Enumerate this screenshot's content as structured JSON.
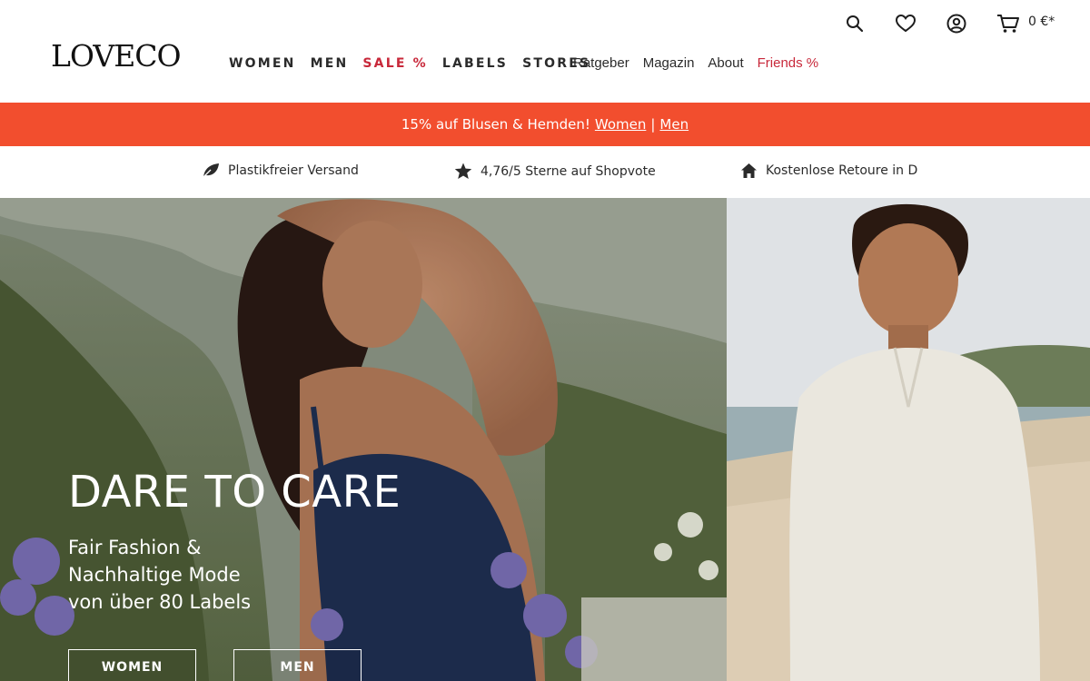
{
  "brand": {
    "logo_text": "LOVECO"
  },
  "main_nav": [
    {
      "label": "WOMEN"
    },
    {
      "label": "MEN"
    },
    {
      "label": "SALE %"
    },
    {
      "label": "LABELS"
    },
    {
      "label": "STORES"
    }
  ],
  "sub_nav": [
    {
      "label": "Ratgeber"
    },
    {
      "label": "Magazin"
    },
    {
      "label": "About"
    },
    {
      "label": "Friends %"
    }
  ],
  "header_icons": {
    "search": "search-icon",
    "wishlist": "heart-icon",
    "account": "user-icon",
    "cart": "cart-icon",
    "cart_total": "0 €*"
  },
  "promo": {
    "text": "15% auf Blusen & Hemden!",
    "link_women": "Women",
    "separator": "|",
    "link_men": "Men",
    "color": "#f24e2e"
  },
  "usp": [
    {
      "icon": "leaf-icon",
      "text": "Plastikfreier Versand"
    },
    {
      "icon": "star-icon",
      "text": "4,76/5 Sterne auf Shopvote"
    },
    {
      "icon": "home-icon",
      "text": "Kostenlose Retoure in D"
    }
  ],
  "hero": {
    "title": "DARE TO CARE",
    "subtitle_lines": [
      "Fair Fashion &",
      "Nachhaltige Mode",
      "von über 80 Labels"
    ],
    "button_women": "WOMEN",
    "button_men": "MEN"
  },
  "colors": {
    "accent_red": "#c8283a",
    "promo_orange": "#f24e2e",
    "text_dark": "#2b2b2b"
  }
}
